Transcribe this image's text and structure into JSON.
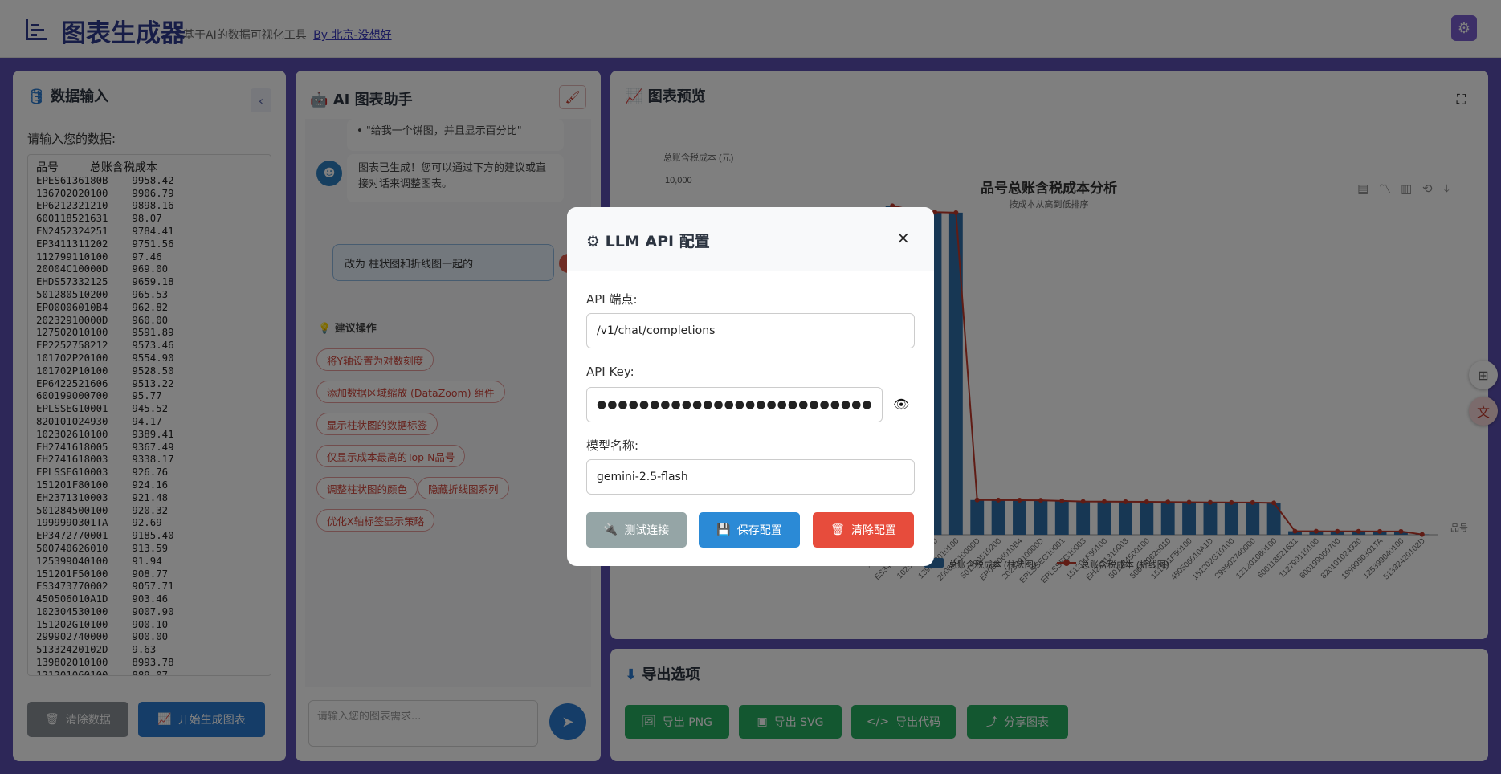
{
  "header": {
    "title": "图表生成器",
    "subtitle": "基于AI的数据可视化工具",
    "author_link": "By 北京-没想好"
  },
  "data_panel": {
    "title": "数据输入",
    "input_label": "请输入您的数据:",
    "column_headers": [
      "品号",
      "总账含税成本"
    ],
    "rows": [
      [
        "EPES6136180B",
        "9958.42"
      ],
      [
        "136702020100",
        "9906.79"
      ],
      [
        "EP6212321210",
        "9898.16"
      ],
      [
        "600118521631",
        "98.07"
      ],
      [
        "EN2452324251",
        "9784.41"
      ],
      [
        "EP3411311202",
        "9751.56"
      ],
      [
        "112799110100",
        "97.46"
      ],
      [
        "20004C10000D",
        "969.00"
      ],
      [
        "EHDS57332125",
        "9659.18"
      ],
      [
        "501280510200",
        "965.53"
      ],
      [
        "EP00006010B4",
        "962.82"
      ],
      [
        "20232910000D",
        "960.00"
      ],
      [
        "127502010100",
        "9591.89"
      ],
      [
        "EP2252758212",
        "9573.46"
      ],
      [
        "101702P20100",
        "9554.90"
      ],
      [
        "101702P10100",
        "9528.50"
      ],
      [
        "EP6422521606",
        "9513.22"
      ],
      [
        "600199000700",
        "95.77"
      ],
      [
        "EPLSSEG10001",
        "945.52"
      ],
      [
        "820101024930",
        "94.17"
      ],
      [
        "102302610100",
        "9389.41"
      ],
      [
        "EH2741618005",
        "9367.49"
      ],
      [
        "EH2741618003",
        "9338.17"
      ],
      [
        "EPLSSEG10003",
        "926.76"
      ],
      [
        "151201F80100",
        "924.16"
      ],
      [
        "EH2371310003",
        "921.48"
      ],
      [
        "501284500100",
        "920.32"
      ],
      [
        "1999990301TA",
        "92.69"
      ],
      [
        "EP3472770001",
        "9185.40"
      ],
      [
        "500740626010",
        "913.59"
      ],
      [
        "125399040100",
        "91.94"
      ],
      [
        "151201F50100",
        "908.77"
      ],
      [
        "ES3473770002",
        "9057.71"
      ],
      [
        "450506010A1D",
        "903.46"
      ],
      [
        "102304530100",
        "9007.90"
      ],
      [
        "151202G10100",
        "900.10"
      ],
      [
        "299902740000",
        "900.00"
      ],
      [
        "51332420102D",
        "9.63"
      ],
      [
        "139802010100",
        "8993.78"
      ],
      [
        "121201060100",
        "889.07"
      ]
    ],
    "clear_button": "清除数据",
    "generate_button": "开始生成图表"
  },
  "ai_panel": {
    "title": "AI 图表助手",
    "bubble_prev": "\"给我一个饼图，并且显示百分比\"",
    "bot_message": "图表已生成！您可以通过下方的建议或直接对话来调整图表。",
    "user_message": "改为 柱状图和折线图一起的",
    "suggest_title": "建议操作",
    "suggestions": [
      "将Y轴设置为对数刻度",
      "添加数据区域缩放 (DataZoom) 组件",
      "显示柱状图的数据标签",
      "仅显示成本最高的Top N品号",
      "调整柱状图的颜色",
      "隐藏折线图系列",
      "优化X轴标签显示策略"
    ],
    "input_placeholder": "请输入您的图表需求..."
  },
  "chart_panel": {
    "title": "图表预览"
  },
  "chart_data": {
    "type": "bar",
    "title": "品号总账含税成本分析",
    "subtitle": "按成本从高到低排序",
    "ylabel": "总账含税成本 (元)",
    "xlabel": "品号",
    "ytick_visible": "10,000",
    "categories": [
      "...003",
      "...2770001",
      "ES3473770002",
      "102304530100",
      "139802010100",
      "20004C10000D",
      "501280510200",
      "EP00006010B4",
      "20232910000D",
      "EPLSSEG10001",
      "EPLSSEG10003",
      "151201F80100",
      "EH2371310003",
      "501284500100",
      "500740626010",
      "151201F50100",
      "450506010A1D",
      "151202G10100",
      "299902740000",
      "121201060100",
      "600118521631",
      "112799110100",
      "600199000700",
      "820101024930",
      "1999990301TA",
      "125399040100",
      "51332420102D"
    ],
    "series": [
      {
        "name": "总账含税成本 (柱状图)",
        "type": "bar",
        "color": "#2f6fa8"
      },
      {
        "name": "总账含税成本 (折线图)",
        "type": "line",
        "color": "#c0392b"
      }
    ],
    "values": [
      9185.4,
      9057.71,
      9007.9,
      8993.78,
      969.0,
      965.53,
      962.82,
      960.0,
      945.52,
      926.76,
      924.16,
      921.48,
      920.32,
      913.59,
      908.77,
      903.46,
      900.1,
      900.0,
      889.07,
      98.07,
      97.46,
      95.77,
      94.17,
      92.69,
      91.94,
      9.63
    ],
    "ylim": [
      0,
      10000
    ],
    "legend": "bottom"
  },
  "export_panel": {
    "title": "导出选项",
    "buttons": [
      "导出 PNG",
      "导出 SVG",
      "导出代码",
      "分享图表"
    ]
  },
  "modal": {
    "title": "LLM API 配置",
    "endpoint_label": "API 端点:",
    "endpoint_value": "/v1/chat/completions",
    "key_label": "API Key:",
    "key_value": "●●●●●●●●●●●●●●●●●●●●●●●●●●●●●●●●●●●●●●●●●●",
    "model_label": "模型名称:",
    "model_value": "gemini-2.5-flash",
    "test_button": "测试连接",
    "save_button": "保存配置",
    "clear_button": "清除配置",
    "close": "×"
  },
  "colors": {
    "primary": "#2b7bd0",
    "danger": "#e74c3c",
    "success": "#27ae60",
    "bar": "#2f6fa8",
    "line": "#c0392b",
    "background": "#5b4fb0"
  }
}
